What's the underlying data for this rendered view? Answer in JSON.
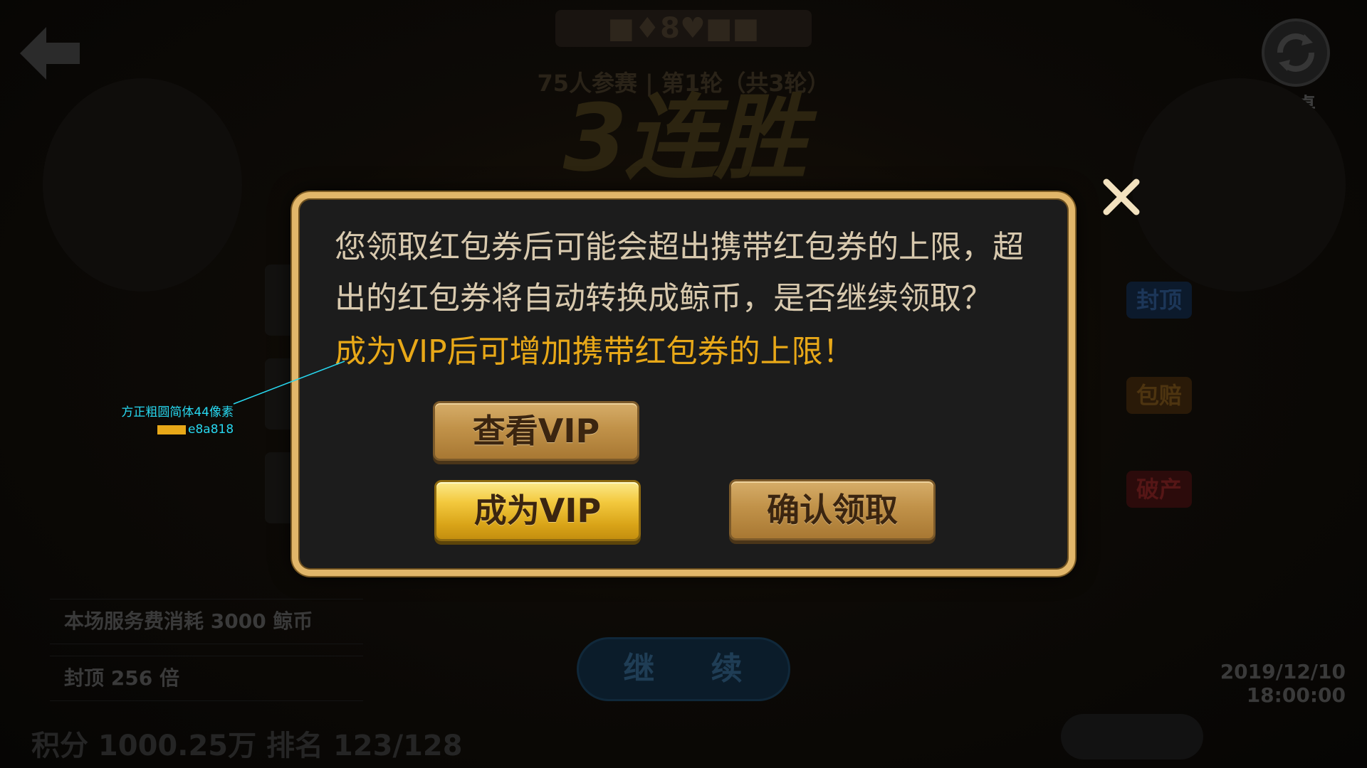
{
  "background": {
    "refresh_label": "换桌",
    "top_title": "■♦8♥■■",
    "sub_title": "75人参赛 | 第1轮（共3轮）",
    "streak_title": "3连胜",
    "tags": [
      "封顶",
      "包赔",
      "破产"
    ],
    "service_fee": "本场服务费消耗 3000 鲸币",
    "cap_multiplier": "封顶 256 倍",
    "continue_label": "继 续",
    "datetime": "2019/12/10  18:00:00",
    "score_row": "积分  1000.25万  排名    123/128"
  },
  "annotation": {
    "font_note": "方正粗圆简体44像素",
    "color_note": "e8a818",
    "swatch_color": "#e8a818",
    "line_color": "#27d8f0"
  },
  "dialog": {
    "message_line1": "您领取红包券后可能会超出携带红包券的上限，超",
    "message_line2": "出的红包券将自动转换成鲸币，是否继续领取？",
    "vip_hint": "成为VIP后可增加携带红包券的上限！",
    "view_vip_label": "查看VIP",
    "become_vip_label": "成为VIP",
    "confirm_label": "确认领取",
    "border_color": "#e1b66a",
    "hint_color": "#e8a818"
  }
}
